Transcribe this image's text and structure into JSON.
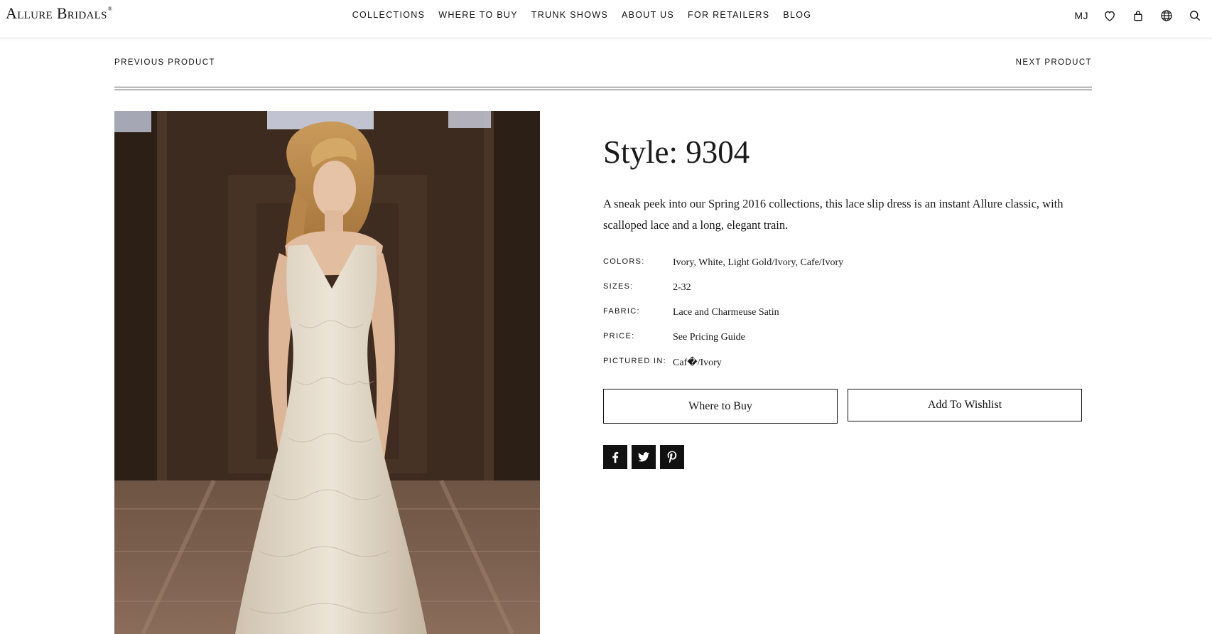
{
  "brand": {
    "logo_text": "Allure Bridals",
    "logo_mark": "®"
  },
  "nav": {
    "items": [
      {
        "label": "COLLECTIONS"
      },
      {
        "label": "WHERE TO BUY"
      },
      {
        "label": "TRUNK SHOWS"
      },
      {
        "label": "ABOUT US"
      },
      {
        "label": "FOR RETAILERS"
      },
      {
        "label": "BLOG"
      }
    ]
  },
  "utility": {
    "initials": "MJ",
    "icons": [
      "heart-icon",
      "bag-icon",
      "globe-icon",
      "search-icon"
    ]
  },
  "product_nav": {
    "previous": "PREVIOUS PRODUCT",
    "next": "NEXT PRODUCT"
  },
  "product": {
    "title": "Style: 9304",
    "description": "A sneak peek into our Spring 2016 collections, this lace slip dress is an instant Allure classic, with scalloped lace and a long, elegant train.",
    "specs": [
      {
        "label": "COLORS:",
        "value": "Ivory, White, Light Gold/Ivory, Cafe/Ivory"
      },
      {
        "label": "SIZES:",
        "value": "2-32"
      },
      {
        "label": "FABRIC:",
        "value": "Lace and Charmeuse Satin"
      },
      {
        "label": "PRICE:",
        "value": "See Pricing Guide"
      },
      {
        "label": "PICTURED IN:",
        "value": "Caf�/Ivory"
      }
    ],
    "buttons": {
      "where_to_buy": "Where to Buy",
      "add_to_wishlist": "Add To Wishlist"
    },
    "social": [
      "facebook-icon",
      "twitter-icon",
      "pinterest-icon"
    ]
  },
  "colors": {
    "text": "#1a1a1a",
    "social_bg": "#111111",
    "border": "#111111"
  }
}
